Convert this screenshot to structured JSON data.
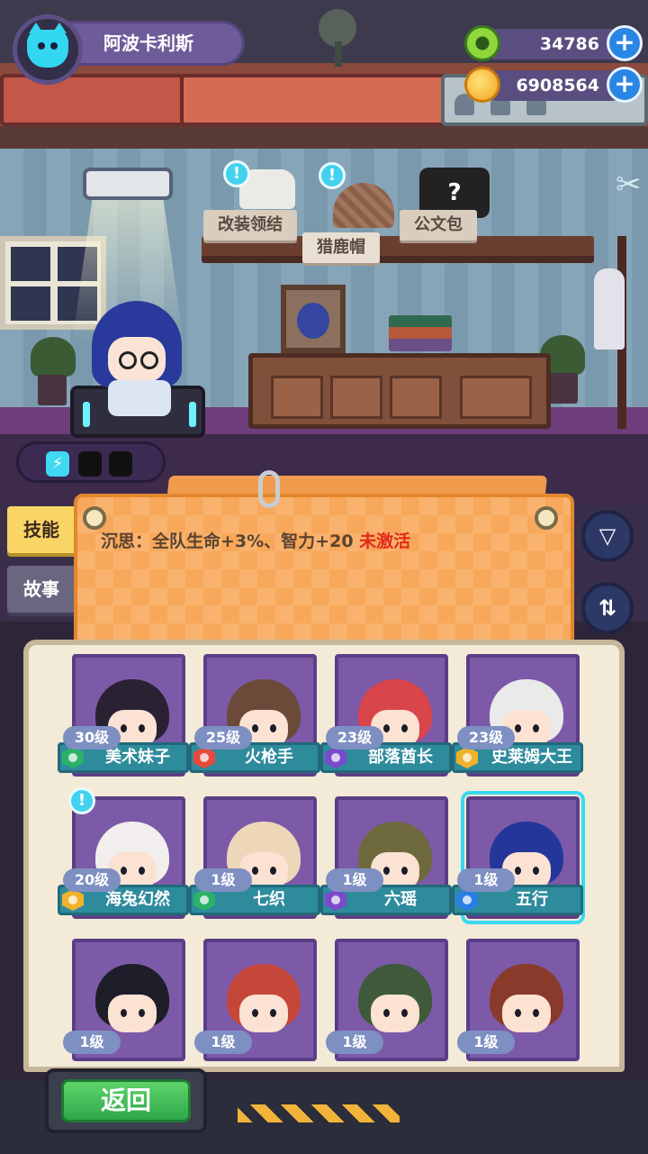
{
  "player": {
    "name": "阿波卡利斯",
    "avatar_icon": "cat-icon"
  },
  "resources": [
    {
      "name": "jade-currency",
      "value": "34786",
      "icon": "jade-coin-icon"
    },
    {
      "name": "gold-currency",
      "value": "6908564",
      "icon": "gold-coin-icon"
    }
  ],
  "room": {
    "items": [
      {
        "label": "改装领结",
        "icon": "bow-tie-icon",
        "has_alert": true
      },
      {
        "label": "猎鹿帽",
        "icon": "deerstalker-hat-icon",
        "has_alert": true
      },
      {
        "label": "公文包",
        "icon": "briefcase-icon",
        "locked_mark": "?",
        "has_alert": false
      }
    ],
    "alert_mark": "!"
  },
  "energy": {
    "slots_filled": 1,
    "slots_total": 3,
    "icon": "battery-icon"
  },
  "side_tabs": [
    {
      "label": "技能",
      "active": true
    },
    {
      "label": "故事",
      "active": false
    }
  ],
  "skill": {
    "text": "沉思：全队生命+3%、智力+20",
    "status": "未激活"
  },
  "buttons": {
    "filter_icon": "filter-icon",
    "sort_icon": "swap-icon",
    "back": "返回"
  },
  "characters": [
    {
      "level": "30级",
      "name": "美术妹子",
      "element": "green",
      "hair": "#2a2233",
      "selected": false,
      "alert": false
    },
    {
      "level": "25级",
      "name": "火枪手",
      "element": "red",
      "hair": "#6b4a3a",
      "selected": false,
      "alert": false
    },
    {
      "level": "23级",
      "name": "部落酋长",
      "element": "purple",
      "hair": "#d8454a",
      "selected": false,
      "alert": false
    },
    {
      "level": "23级",
      "name": "史莱姆大王",
      "element": "gold",
      "hair": "#eaeaea",
      "selected": false,
      "alert": false
    },
    {
      "level": "20级",
      "name": "海兔幻然",
      "element": "gold",
      "hair": "#f2eeee",
      "selected": false,
      "alert": true
    },
    {
      "level": "1级",
      "name": "七织",
      "element": "green",
      "hair": "#eed7b8",
      "selected": false,
      "alert": false
    },
    {
      "level": "1级",
      "name": "六瑶",
      "element": "purple",
      "hair": "#6e6a3e",
      "selected": false,
      "alert": false
    },
    {
      "level": "1级",
      "name": "五行",
      "element": "blue",
      "hair": "#25369a",
      "selected": true,
      "alert": false
    },
    {
      "level": "1级",
      "name": "",
      "element": "",
      "hair": "#1e1e2a",
      "selected": false,
      "alert": false
    },
    {
      "level": "1级",
      "name": "",
      "element": "",
      "hair": "#c4473a",
      "selected": false,
      "alert": false
    },
    {
      "level": "1级",
      "name": "",
      "element": "",
      "hair": "#3e5a3a",
      "selected": false,
      "alert": false
    },
    {
      "level": "1级",
      "name": "",
      "element": "",
      "hair": "#8a3a2a",
      "selected": false,
      "alert": false
    }
  ]
}
